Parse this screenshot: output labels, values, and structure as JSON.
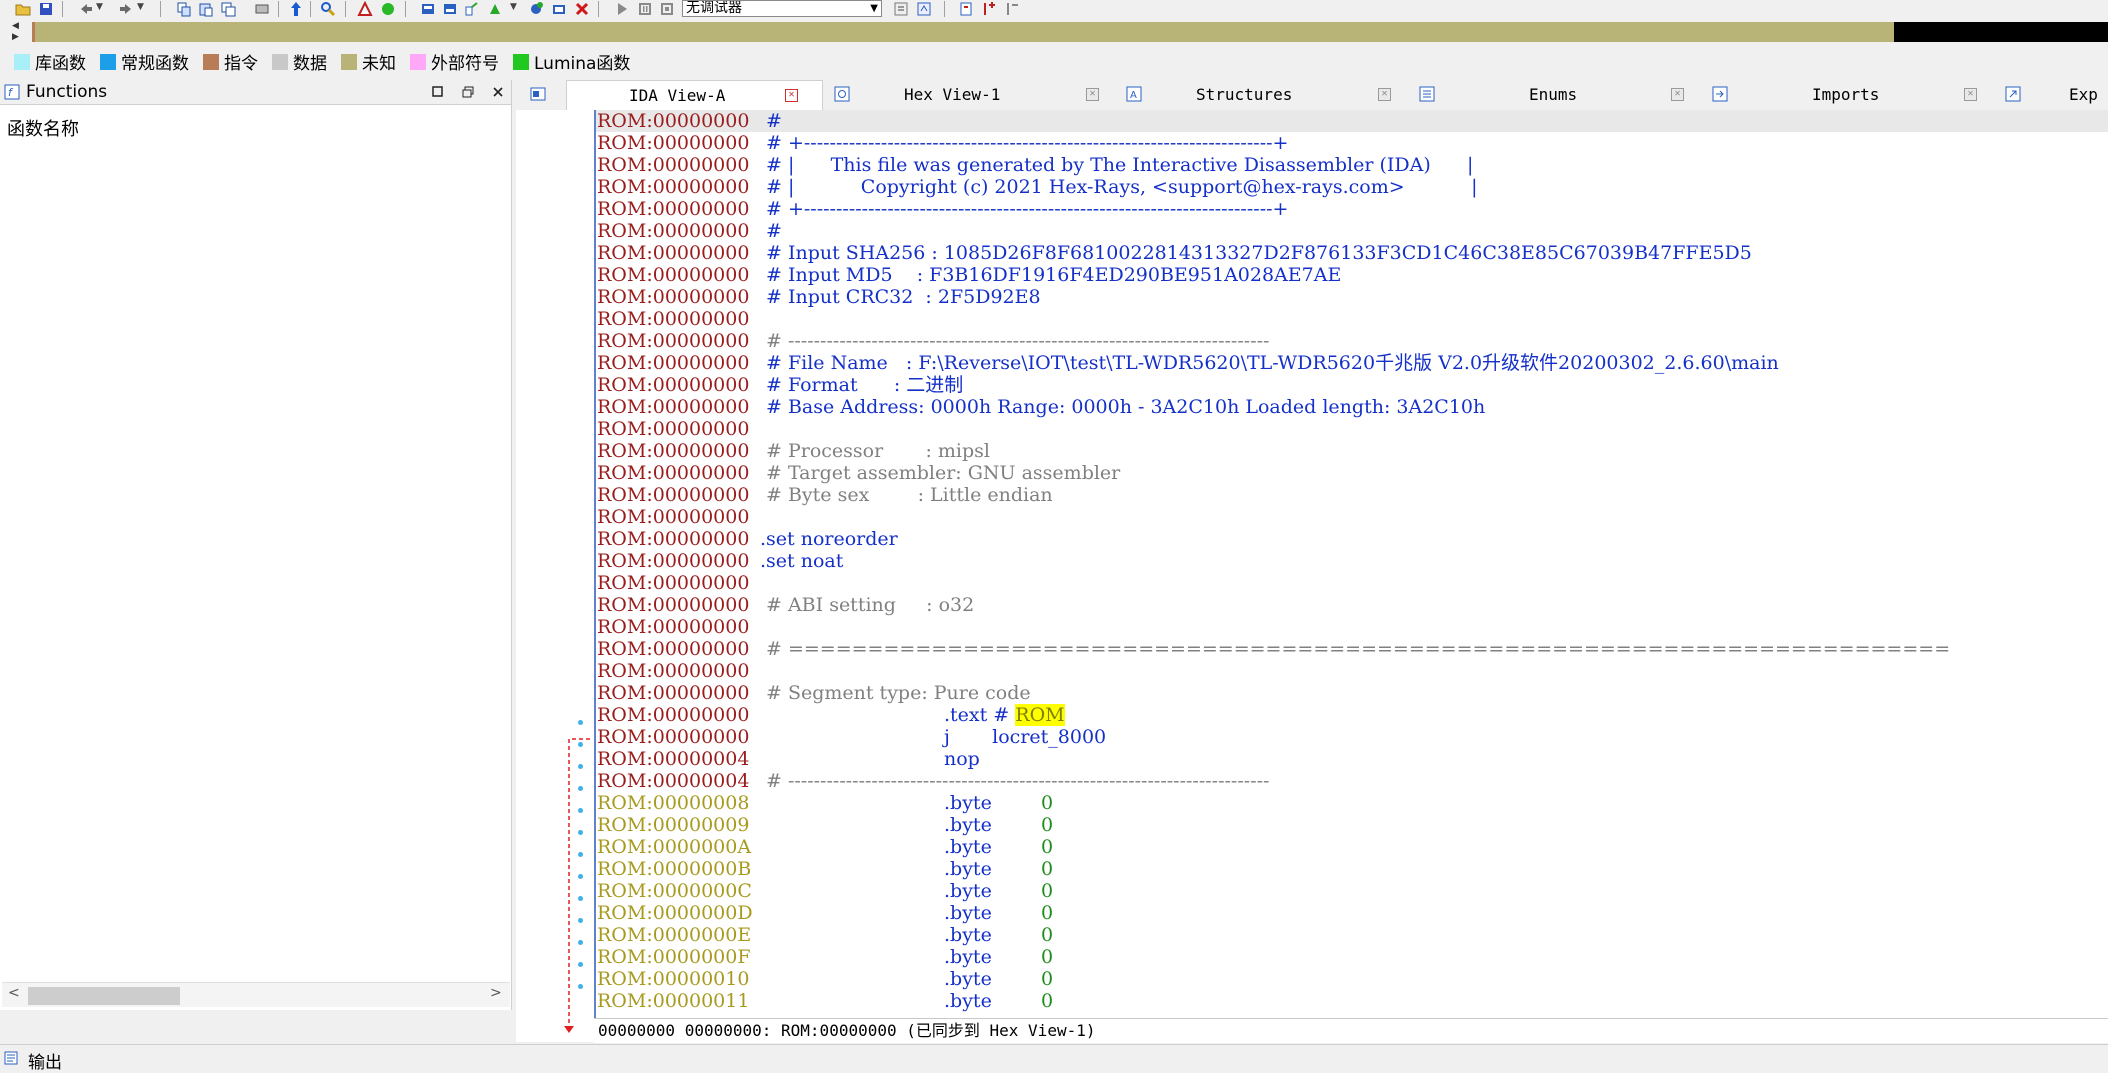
{
  "toolbar": {
    "debugger_select": "无调试器",
    "icons": [
      "open-icon",
      "save-icon",
      "back-icon",
      "forward-icon",
      "copy-icon",
      "paste-icon",
      "find-icon",
      "jump-icon",
      "search-icon",
      "graph-icon",
      "start-icon",
      "breakpoint-icon",
      "run-icon",
      "pause-icon",
      "stop-icon",
      "close-icon"
    ]
  },
  "legend": [
    {
      "label": "库函数",
      "color": "#a8f0f8"
    },
    {
      "label": "常规函数",
      "color": "#1c9ee8"
    },
    {
      "label": "指令",
      "color": "#b87c56"
    },
    {
      "label": "数据",
      "color": "#c8c8c8"
    },
    {
      "label": "未知",
      "color": "#b8b478"
    },
    {
      "label": "外部符号",
      "color": "#ffa8f8"
    },
    {
      "label": "Lumina函数",
      "color": "#22c822"
    }
  ],
  "functions_panel": {
    "title": "Functions",
    "column_header": "函数名称"
  },
  "tabs": [
    {
      "label": "IDA View-A",
      "active": true
    },
    {
      "label": "Hex View-1",
      "active": false
    },
    {
      "label": "Structures",
      "active": false
    },
    {
      "label": "Enums",
      "active": false
    },
    {
      "label": "Imports",
      "active": false
    },
    {
      "label": "Exp",
      "active": false
    }
  ],
  "disasm_lines": [
    {
      "addr": "ROM:00000000",
      "text": "#",
      "indent": 0,
      "kind": "comment-blue",
      "selected": true
    },
    {
      "addr": "ROM:00000000",
      "text": "# +-------------------------------------------------------------------------+",
      "indent": 0,
      "kind": "comment-blue"
    },
    {
      "addr": "ROM:00000000",
      "text": "# |      This file was generated by The Interactive Disassembler (IDA)      |",
      "indent": 0,
      "kind": "comment-blue"
    },
    {
      "addr": "ROM:00000000",
      "text": "# |           Copyright (c) 2021 Hex-Rays, <support@hex-rays.com>           |",
      "indent": 0,
      "kind": "comment-blue"
    },
    {
      "addr": "ROM:00000000",
      "text": "# +-------------------------------------------------------------------------+",
      "indent": 0,
      "kind": "comment-blue"
    },
    {
      "addr": "ROM:00000000",
      "text": "#",
      "indent": 0,
      "kind": "comment-blue"
    },
    {
      "addr": "ROM:00000000",
      "text": "# Input SHA256 : 1085D26F8F6810022814313327D2F876133F3CD1C46C38E85C67039B47FFE5D5",
      "indent": 0,
      "kind": "comment-blue"
    },
    {
      "addr": "ROM:00000000",
      "text": "# Input MD5    : F3B16DF1916F4ED290BE951A028AE7AE",
      "indent": 0,
      "kind": "comment-blue"
    },
    {
      "addr": "ROM:00000000",
      "text": "# Input CRC32  : 2F5D92E8",
      "indent": 0,
      "kind": "comment-blue"
    },
    {
      "addr": "ROM:00000000",
      "text": "",
      "indent": 0,
      "kind": "plain"
    },
    {
      "addr": "ROM:00000000",
      "text": "# ---------------------------------------------------------------------------",
      "indent": 0,
      "kind": "comment-gray"
    },
    {
      "addr": "ROM:00000000",
      "text": "# File Name   : F:\\Reverse\\IOT\\test\\TL-WDR5620\\TL-WDR5620千兆版 V2.0升级软件20200302_2.6.60\\main",
      "indent": 0,
      "kind": "comment-blue"
    },
    {
      "addr": "ROM:00000000",
      "text": "# Format      : 二进制",
      "indent": 0,
      "kind": "comment-blue"
    },
    {
      "addr": "ROM:00000000",
      "text": "# Base Address: 0000h Range: 0000h - 3A2C10h Loaded length: 3A2C10h",
      "indent": 0,
      "kind": "comment-blue"
    },
    {
      "addr": "ROM:00000000",
      "text": "",
      "indent": 0,
      "kind": "plain"
    },
    {
      "addr": "ROM:00000000",
      "text": "# Processor       : mipsl",
      "indent": 0,
      "kind": "comment-gray"
    },
    {
      "addr": "ROM:00000000",
      "text": "# Target assembler: GNU assembler",
      "indent": 0,
      "kind": "comment-gray"
    },
    {
      "addr": "ROM:00000000",
      "text": "# Byte sex        : Little endian",
      "indent": 0,
      "kind": "comment-gray"
    },
    {
      "addr": "ROM:00000000",
      "text": "",
      "indent": 0,
      "kind": "plain"
    },
    {
      "addr": "ROM:00000000",
      "text": ".set noreorder",
      "indent": 1,
      "kind": "directive"
    },
    {
      "addr": "ROM:00000000",
      "text": ".set noat",
      "indent": 1,
      "kind": "directive"
    },
    {
      "addr": "ROM:00000000",
      "text": "",
      "indent": 0,
      "kind": "plain"
    },
    {
      "addr": "ROM:00000000",
      "text": "# ABI setting     : o32",
      "indent": 0,
      "kind": "comment-gray"
    },
    {
      "addr": "ROM:00000000",
      "text": "",
      "indent": 0,
      "kind": "plain"
    },
    {
      "addr": "ROM:00000000",
      "text": "# =========================================================================",
      "indent": 0,
      "kind": "comment-gray"
    },
    {
      "addr": "ROM:00000000",
      "text": "",
      "indent": 0,
      "kind": "plain"
    },
    {
      "addr": "ROM:00000000",
      "text": "# Segment type: Pure code",
      "indent": 0,
      "kind": "comment-gray"
    },
    {
      "addr": "ROM:00000000",
      "text": ".text # ",
      "hl": "ROM",
      "indent": 2,
      "kind": "segment"
    },
    {
      "addr": "ROM:00000000",
      "text": "j       locret_8000",
      "indent": 2,
      "kind": "code"
    },
    {
      "addr": "ROM:00000004",
      "text": "nop",
      "indent": 2,
      "kind": "code"
    },
    {
      "addr": "ROM:00000004",
      "text": "# ---------------------------------------------------------------------------",
      "indent": 0,
      "kind": "comment-gray"
    },
    {
      "addr": "ROM:00000008",
      "text": ".byte",
      "value": "0",
      "indent": 2,
      "kind": "data"
    },
    {
      "addr": "ROM:00000009",
      "text": ".byte",
      "value": "0",
      "indent": 2,
      "kind": "data"
    },
    {
      "addr": "ROM:0000000A",
      "text": ".byte",
      "value": "0",
      "indent": 2,
      "kind": "data"
    },
    {
      "addr": "ROM:0000000B",
      "text": ".byte",
      "value": "0",
      "indent": 2,
      "kind": "data"
    },
    {
      "addr": "ROM:0000000C",
      "text": ".byte",
      "value": "0",
      "indent": 2,
      "kind": "data"
    },
    {
      "addr": "ROM:0000000D",
      "text": ".byte",
      "value": "0",
      "indent": 2,
      "kind": "data"
    },
    {
      "addr": "ROM:0000000E",
      "text": ".byte",
      "value": "0",
      "indent": 2,
      "kind": "data"
    },
    {
      "addr": "ROM:0000000F",
      "text": ".byte",
      "value": "0",
      "indent": 2,
      "kind": "data"
    },
    {
      "addr": "ROM:00000010",
      "text": ".byte",
      "value": "0",
      "indent": 2,
      "kind": "data"
    },
    {
      "addr": "ROM:00000011",
      "text": ".byte",
      "value": "0",
      "indent": 2,
      "kind": "data"
    }
  ],
  "status": {
    "disasm_status": "00000000 00000000: ROM:00000000 (已同步到 Hex View-1)"
  },
  "output": {
    "label": "输出"
  }
}
